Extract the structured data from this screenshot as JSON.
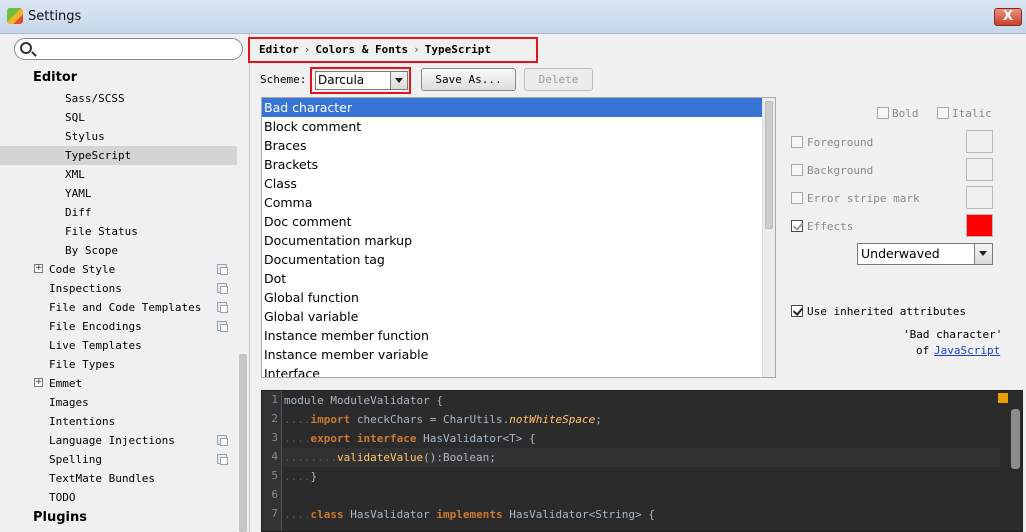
{
  "window": {
    "title": "Settings",
    "close_label": "X"
  },
  "search": {
    "placeholder": ""
  },
  "sidebar": {
    "rows": [
      {
        "label": "Editor",
        "section": true,
        "indent": 33
      },
      {
        "label": "Sass/SCSS",
        "indent": 65
      },
      {
        "label": "SQL",
        "indent": 65
      },
      {
        "label": "Stylus",
        "indent": 65
      },
      {
        "label": "TypeScript",
        "indent": 65,
        "selected": true
      },
      {
        "label": "XML",
        "indent": 65
      },
      {
        "label": "YAML",
        "indent": 65
      },
      {
        "label": "Diff",
        "indent": 65
      },
      {
        "label": "File Status",
        "indent": 65
      },
      {
        "label": "By Scope",
        "indent": 65
      },
      {
        "label": "Code Style",
        "indent": 49,
        "expander": true,
        "copy": true
      },
      {
        "label": "Inspections",
        "indent": 49,
        "copy": true
      },
      {
        "label": "File and Code Templates",
        "indent": 49,
        "copy": true
      },
      {
        "label": "File Encodings",
        "indent": 49,
        "copy": true
      },
      {
        "label": "Live Templates",
        "indent": 49
      },
      {
        "label": "File Types",
        "indent": 49
      },
      {
        "label": "Emmet",
        "indent": 49,
        "expander": true
      },
      {
        "label": "Images",
        "indent": 49
      },
      {
        "label": "Intentions",
        "indent": 49
      },
      {
        "label": "Language Injections",
        "indent": 49,
        "copy": true
      },
      {
        "label": "Spelling",
        "indent": 49,
        "copy": true
      },
      {
        "label": "TextMate Bundles",
        "indent": 49
      },
      {
        "label": "TODO",
        "indent": 49
      },
      {
        "label": "Plugins",
        "section": true,
        "indent": 33
      }
    ]
  },
  "breadcrumb": [
    "Editor",
    "Colors & Fonts",
    "TypeScript"
  ],
  "breadcrumb_sep": "›",
  "scheme": {
    "label": "Scheme:",
    "value": "Darcula",
    "save_as": "Save As...",
    "delete": "Delete"
  },
  "attributes": [
    "Bad character",
    "Block comment",
    "Braces",
    "Brackets",
    "Class",
    "Comma",
    "Doc comment",
    "Documentation markup",
    "Documentation tag",
    "Dot",
    "Global function",
    "Global variable",
    "Instance member function",
    "Instance member variable",
    "Interface"
  ],
  "selected_attribute": 0,
  "options": {
    "bold": "Bold",
    "italic": "Italic",
    "foreground": "Foreground",
    "background": "Background",
    "error_stripe": "Error stripe mark",
    "effects": "Effects",
    "effect_type": "Underwaved",
    "effect_color": "#ff0000",
    "use_inherited": "Use inherited attributes",
    "inherit_quote": "'Bad character'",
    "inherit_of": "of",
    "inherit_link": "JavaScript"
  },
  "editor": {
    "line_numbers": [
      "1",
      "2",
      "3",
      "4",
      "5",
      "6",
      "7"
    ],
    "lines": [
      [
        [
          "",
          "module ModuleValidator {"
        ]
      ],
      [
        [
          "dots",
          "...."
        ],
        [
          "kw",
          "import"
        ],
        [
          "",
          " checkChars = CharUtils."
        ],
        [
          "it",
          "notWhiteSpace"
        ],
        [
          "",
          ";"
        ]
      ],
      [
        [
          "dots",
          "...."
        ],
        [
          "kw",
          "export interface"
        ],
        [
          "",
          " HasValidator<T> {"
        ]
      ],
      [
        [
          "dots",
          "........"
        ],
        [
          "fn",
          "validateValue"
        ],
        [
          "",
          "():Boolean;"
        ]
      ],
      [
        [
          "dots",
          "...."
        ],
        [
          "",
          "}"
        ]
      ],
      [],
      [
        [
          "dots",
          "...."
        ],
        [
          "kw",
          "class"
        ],
        [
          "",
          " HasValidator "
        ],
        [
          "kw",
          "implements"
        ],
        [
          "",
          " HasValidator<String> {"
        ]
      ]
    ]
  }
}
